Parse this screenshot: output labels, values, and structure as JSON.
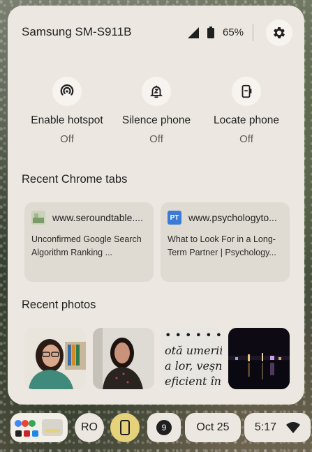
{
  "header": {
    "device_name": "Samsung SM-S911B",
    "battery_percent": "65%"
  },
  "quick_actions": [
    {
      "label": "Enable hotspot",
      "status": "Off",
      "icon": "hotspot-icon"
    },
    {
      "label": "Silence phone",
      "status": "Off",
      "icon": "silence-bell-icon"
    },
    {
      "label": "Locate phone",
      "status": "Off",
      "icon": "locate-phone-icon"
    }
  ],
  "recent_tabs": {
    "title": "Recent Chrome tabs",
    "items": [
      {
        "url": "www.seroundtable....",
        "title": "Unconfirmed Google Search Algorithm Ranking ..."
      },
      {
        "url": "www.psychologyto...",
        "title": "What to Look For in a Long-Term Partner | Psychology...",
        "favicon_text": "PT"
      }
    ]
  },
  "recent_photos": {
    "title": "Recent photos",
    "items": [
      {
        "text_lines": []
      },
      {
        "text_lines": []
      },
      {
        "text_lines": [
          "• • • • • • •",
          "otă umerii.",
          "a lor, veșn",
          "eficient în"
        ]
      },
      {
        "text_lines": []
      }
    ]
  },
  "shelf": {
    "ime_label": "RO",
    "notification_count": "9",
    "date": "Oct 25",
    "time": "5:17"
  },
  "colors": {
    "panel_bg": "#ece8e1",
    "accent_yellow": "#e6d27a",
    "pt_favicon": "#3b7bd8"
  }
}
